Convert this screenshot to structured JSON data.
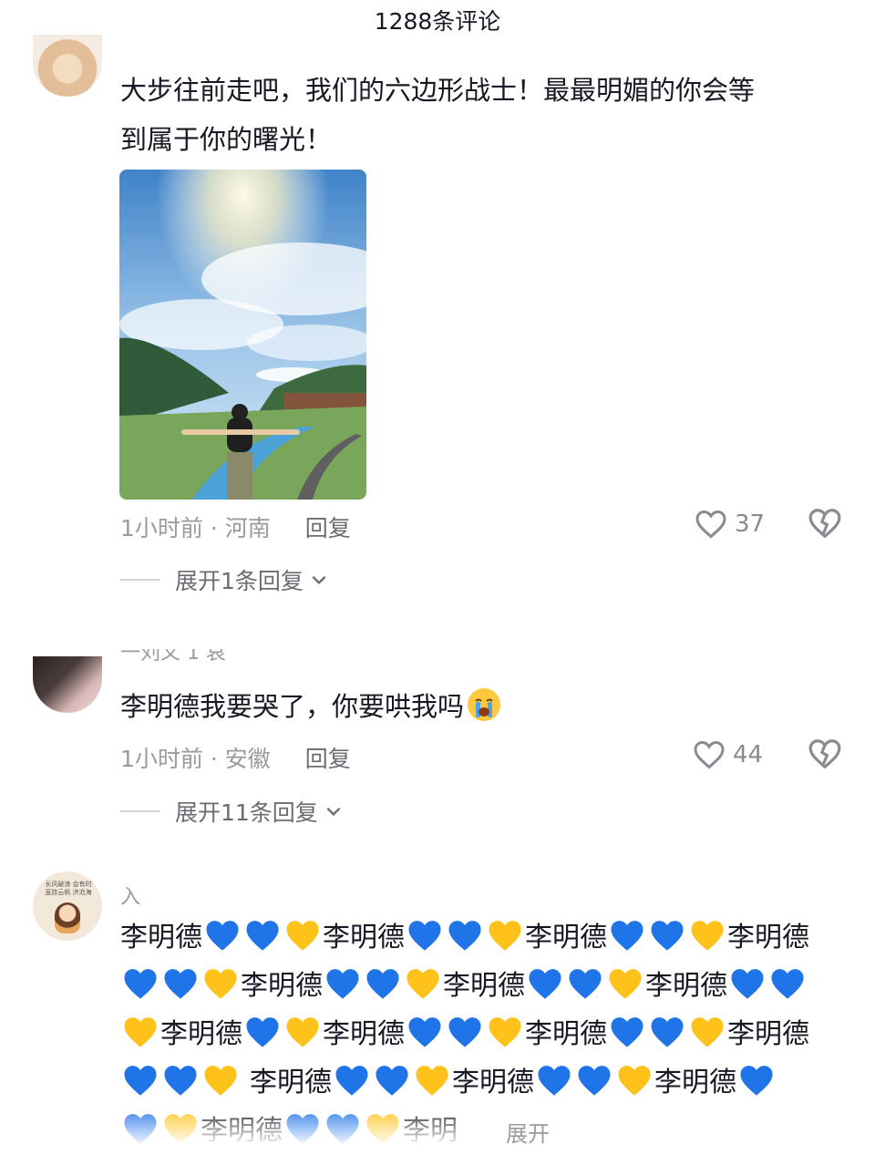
{
  "header": {
    "title": "1288条评论"
  },
  "comments": [
    {
      "text_line1": "大步往前走吧，我们的六边形战士！最最明媚的你会等",
      "text_line2": "到属于你的曙光！",
      "meta": "1小时前 · 河南",
      "reply_label": "回复",
      "likes": "37",
      "expand_label": "展开1条回复"
    },
    {
      "username_partial": "一刘义 1 哀",
      "text": "李明德我要哭了，你要哄我吗",
      "emoji": "crying-face",
      "meta": "1小时前 · 安徽",
      "reply_label": "回复",
      "likes": "44",
      "expand_label": "展开11条回复"
    },
    {
      "username": "入",
      "avatar_text": "长风破浪 会有时 直挂云帆 济沧海",
      "name_word": "李明德",
      "truncated_word": "李明",
      "expand_inline": "展开"
    }
  ],
  "colors": {
    "blue_heart": "#1f74e8",
    "yellow_heart": "#ffc21a",
    "meta_gray": "#9a9aa0"
  }
}
